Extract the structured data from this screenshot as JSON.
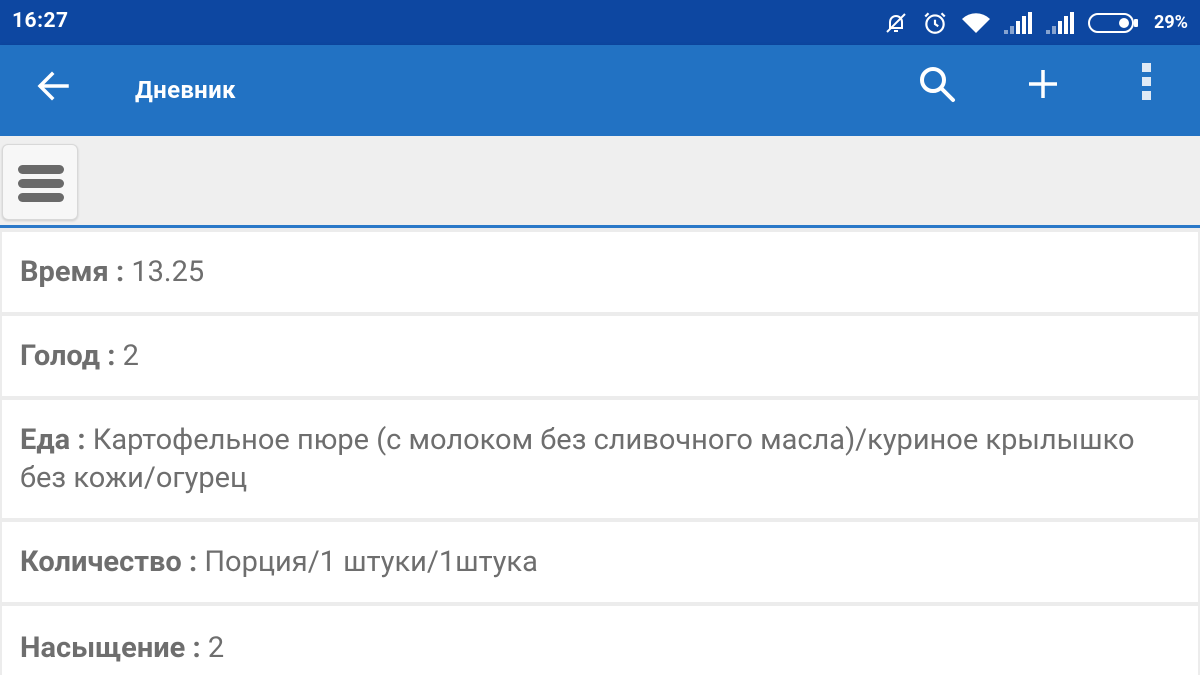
{
  "colors": {
    "status_bg": "#0d47a1",
    "appbar_bg": "#2272c3",
    "accent": "#2a78c8",
    "text": "#6e6e6e"
  },
  "status_bar": {
    "time": "16:27",
    "battery_percent": "29%",
    "icons": [
      "alarm-off-icon",
      "alarm-clock-icon",
      "wifi-icon",
      "signal-icon",
      "signal-icon",
      "battery-icon"
    ]
  },
  "appbar": {
    "title": "Дневник",
    "icons": [
      "arrow-left-icon",
      "search-icon",
      "plus-icon",
      "more-vertical-icon"
    ]
  },
  "toolbar": {
    "icons": [
      "hamburger-menu-icon"
    ]
  },
  "entries": [
    {
      "label": "Время",
      "sep": " : ",
      "value": "13.25"
    },
    {
      "label": "Голод",
      "sep": " : ",
      "value": "2"
    },
    {
      "label": "Еда",
      "sep": " : ",
      "value": "Картофельное пюре (с молоком без сливочного масла)/куриное крылышко без кожи/огурец"
    },
    {
      "label": "Количество",
      "sep": " : ",
      "value": "Порция/1 штуки/1штука"
    },
    {
      "label": "Насыщение",
      "sep": " : ",
      "value": "2"
    }
  ]
}
